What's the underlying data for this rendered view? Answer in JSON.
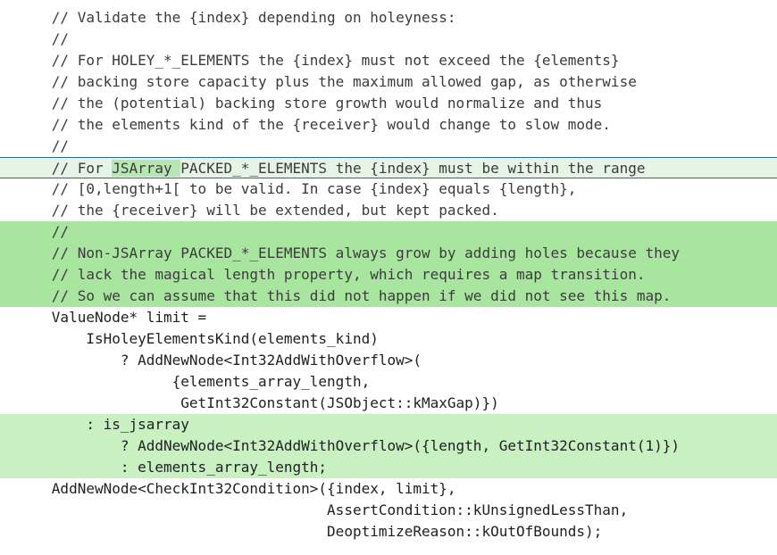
{
  "code_lines": [
    {
      "text": "      // Validate the {index} depending on holeyness:"
    },
    {
      "text": "      //"
    },
    {
      "text": "      // For HOLEY_*_ELEMENTS the {index} must not exceed the {elements}"
    },
    {
      "text": "      // backing store capacity plus the maximum allowed gap, as otherwise"
    },
    {
      "text": "      // the (potential) backing store growth would normalize and thus"
    },
    {
      "text": "      // the elements kind of the {receiver} would change to slow mode."
    },
    {
      "text": "      //"
    },
    {
      "pre": "      // For ",
      "mark": "JSArray ",
      "post": "PACKED_*_ELEMENTS the {index} must be within the range"
    },
    {
      "text": "      // [0,length+1[ to be valid. In case {index} equals {length},"
    },
    {
      "text": "      // the {receiver} will be extended, but kept packed."
    },
    {
      "text": "      //"
    },
    {
      "text": "      // Non-JSArray PACKED_*_ELEMENTS always grow by adding holes because they"
    },
    {
      "text": "      // lack the magical length property, which requires a map transition."
    },
    {
      "text": "      // So we can assume that this did not happen if we did not see this map."
    },
    {
      "text": "      ValueNode* limit ="
    },
    {
      "text": "          IsHoleyElementsKind(elements_kind)"
    },
    {
      "text": "              ? AddNewNode<Int32AddWithOverflow>("
    },
    {
      "text": "                    {elements_array_length,"
    },
    {
      "text": "                     GetInt32Constant(JSObject::kMaxGap)})"
    },
    {
      "text": "          : is_jsarray"
    },
    {
      "text": "              ? AddNewNode<Int32AddWithOverflow>({length, GetInt32Constant(1)})"
    },
    {
      "text": "              : elements_array_length;"
    },
    {
      "text": "      AddNewNode<CheckInt32Condition>({index, limit},"
    },
    {
      "text": "                                      AssertCondition::kUnsignedLessThan,"
    },
    {
      "text": "                                      DeoptimizeReason::kOutOfBounds);"
    }
  ],
  "highlight_colors": {
    "light": "#e6f4e6",
    "strong": "#a8e6a0",
    "mid": "#c8f0c0",
    "border": "#2e6b8a"
  }
}
